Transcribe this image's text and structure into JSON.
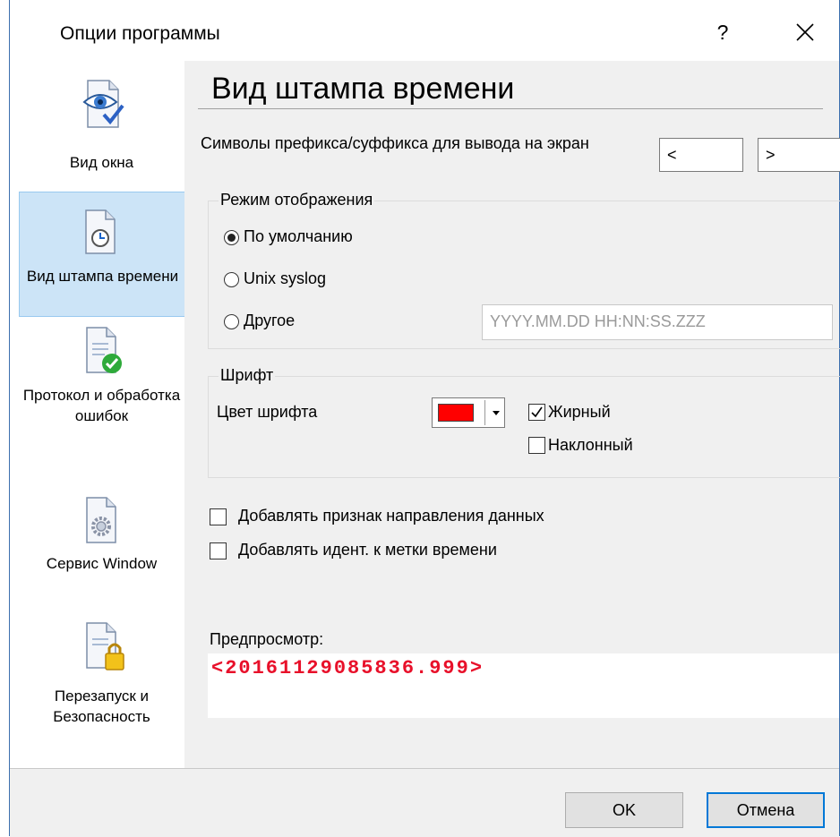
{
  "window": {
    "title": "Опции программы",
    "help_label": "?",
    "accent_color": "#0078d7"
  },
  "sidebar": {
    "items": [
      {
        "label": "Вид окна",
        "icon": "eye-document-icon",
        "selected": false
      },
      {
        "label": "Вид штампа времени",
        "icon": "clock-document-icon",
        "selected": true
      },
      {
        "label": "Протокол и обработка ошибок",
        "icon": "checkmark-document-icon",
        "selected": false
      },
      {
        "label": "Сервис Window",
        "icon": "gear-document-icon",
        "selected": false
      },
      {
        "label": "Перезапуск и Безопасность",
        "icon": "lock-document-icon",
        "selected": false
      }
    ]
  },
  "page": {
    "title": "Вид штампа времени",
    "prefix_suffix_label": "Символы префикса/суффикса для вывода на экран",
    "prefix_value": "<",
    "suffix_value": ">",
    "display_mode": {
      "legend": "Режим отображения",
      "options": [
        {
          "label": "По умолчанию",
          "checked": true
        },
        {
          "label": "Unix syslog",
          "checked": false
        },
        {
          "label": "Другое",
          "checked": false
        }
      ],
      "custom_format_placeholder": "YYYY.MM.DD HH:NN:SS.ZZZ"
    },
    "font": {
      "legend": "Шрифт",
      "color_label": "Цвет шрифта",
      "color_value": "#ff0000",
      "bold_label": "Жирный",
      "bold_checked": true,
      "italic_label": "Наклонный",
      "italic_checked": false
    },
    "options": [
      {
        "label": "Добавлять признак направления данных",
        "checked": false
      },
      {
        "label": "Добавлять идент. к метки времени",
        "checked": false
      }
    ],
    "preview": {
      "label": "Предпросмотр:",
      "text": "<20161129085836.999>",
      "color": "#e8102a"
    }
  },
  "footer": {
    "ok_label": "OK",
    "cancel_label": "Отмена"
  }
}
